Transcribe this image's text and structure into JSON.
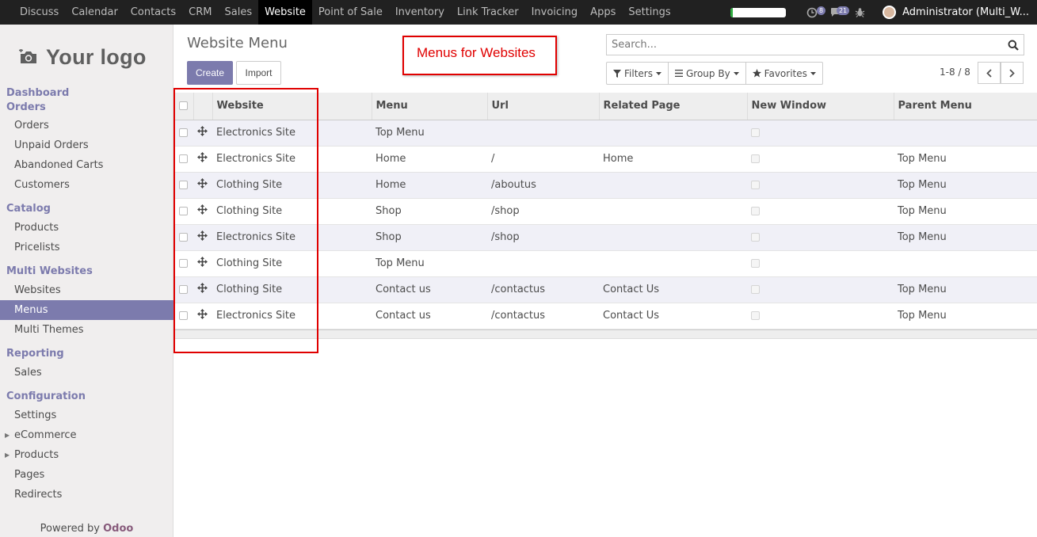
{
  "topbar": {
    "menus": [
      "Discuss",
      "Calendar",
      "Contacts",
      "CRM",
      "Sales",
      "Website",
      "Point of Sale",
      "Inventory",
      "Link Tracker",
      "Invoicing",
      "Apps",
      "Settings"
    ],
    "active_menu": "Website",
    "progress": 0.04,
    "activity_count": "8",
    "message_count": "21",
    "user": "Administrator (Multi_W..."
  },
  "sidebar": {
    "logo_text": "Your logo",
    "sections": [
      {
        "title": "Dashboard Orders",
        "items": [
          "Orders",
          "Unpaid Orders",
          "Abandoned Carts",
          "Customers"
        ]
      },
      {
        "title": "Catalog",
        "items": [
          "Products",
          "Pricelists"
        ]
      },
      {
        "title": "Multi Websites",
        "items": [
          "Websites",
          "Menus",
          "Multi Themes"
        ]
      },
      {
        "title": "Reporting",
        "items": [
          "Sales"
        ]
      },
      {
        "title": "Configuration",
        "items": [
          "Settings",
          "eCommerce",
          "Products",
          "Pages",
          "Redirects"
        ]
      }
    ],
    "active_item": "Menus",
    "powered_by": "Powered by",
    "powered_brand": "Odoo"
  },
  "control": {
    "title": "Website Menu",
    "create_label": "Create",
    "import_label": "Import",
    "search_placeholder": "Search...",
    "filters_label": "Filters",
    "groupby_label": "Group By",
    "favorites_label": "Favorites",
    "pager": "1-8 / 8"
  },
  "annotation": "Menus for Websites",
  "table": {
    "columns": [
      "Website",
      "Menu",
      "Url",
      "Related Page",
      "New Window",
      "Parent Menu"
    ],
    "rows": [
      [
        "Electronics Site",
        "Top Menu",
        "",
        "",
        "",
        ""
      ],
      [
        "Electronics Site",
        "Home",
        "/",
        "Home",
        "",
        "Top Menu"
      ],
      [
        "Clothing Site",
        "Home",
        "/aboutus",
        "",
        "",
        "Top Menu"
      ],
      [
        "Clothing Site",
        "Shop",
        "/shop",
        "",
        "",
        "Top Menu"
      ],
      [
        "Electronics Site",
        "Shop",
        "/shop",
        "",
        "",
        "Top Menu"
      ],
      [
        "Clothing Site",
        "Top Menu",
        "",
        "",
        "",
        ""
      ],
      [
        "Clothing Site",
        "Contact us",
        "/contactus",
        "Contact Us",
        "",
        "Top Menu"
      ],
      [
        "Electronics Site",
        "Contact us",
        "/contactus",
        "Contact Us",
        "",
        "Top Menu"
      ]
    ]
  }
}
